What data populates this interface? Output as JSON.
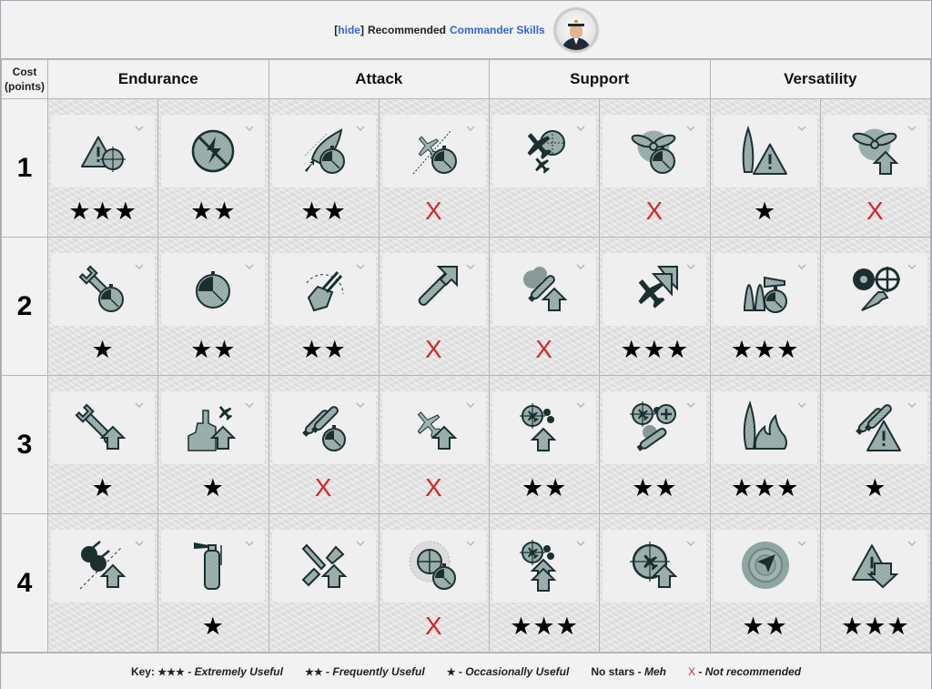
{
  "header": {
    "hide_link": "hide",
    "bracket_open": "[",
    "bracket_close": "]",
    "title_plain": "Recommended",
    "title_link": "Commander Skills",
    "avatar_icon": "commander-portrait-icon"
  },
  "columns": {
    "cost_header_line1": "Cost",
    "cost_header_line2": "(points)",
    "categories": [
      "Endurance",
      "Attack",
      "Support",
      "Versatility"
    ]
  },
  "rows": [
    {
      "cost": "1",
      "skills": [
        {
          "icon": "warning-triangle-target-icon",
          "rating": "★★★"
        },
        {
          "icon": "no-flooding-icon",
          "rating": "★★"
        },
        {
          "icon": "ship-speed-timer-icon",
          "rating": "★★"
        },
        {
          "icon": "aircraft-timer-icon",
          "rating": "X"
        },
        {
          "icon": "fighter-planes-target-icon",
          "rating": ""
        },
        {
          "icon": "propeller-timer-icon",
          "rating": "X"
        },
        {
          "icon": "ship-warning-icon",
          "rating": "★"
        },
        {
          "icon": "propeller-upgrade-icon",
          "rating": "X"
        }
      ]
    },
    {
      "cost": "2",
      "skills": [
        {
          "icon": "wrench-timer-icon",
          "rating": "★"
        },
        {
          "icon": "stopwatch-icon",
          "rating": "★★"
        },
        {
          "icon": "turret-rotation-icon",
          "rating": "★★"
        },
        {
          "icon": "torpedo-upgrade-icon",
          "rating": "X"
        },
        {
          "icon": "smoke-generator-upgrade-icon",
          "rating": "X"
        },
        {
          "icon": "aircraft-speed-upgrade-icon",
          "rating": "★★★"
        },
        {
          "icon": "ships-timer-icon",
          "rating": "★★★"
        },
        {
          "icon": "engine-steering-repair-icon",
          "rating": ""
        }
      ]
    },
    {
      "cost": "3",
      "skills": [
        {
          "icon": "wrench-upgrade-icon",
          "rating": "★"
        },
        {
          "icon": "battleship-aircraft-upgrade-icon",
          "rating": "★"
        },
        {
          "icon": "torpedo-reload-timer-icon",
          "rating": "X"
        },
        {
          "icon": "aircraft-upgrade-icon",
          "rating": "X"
        },
        {
          "icon": "aa-guns-upgrade-icon",
          "rating": "★★"
        },
        {
          "icon": "aa-smoke-plus-icon",
          "rating": "★★"
        },
        {
          "icon": "ship-fire-icon",
          "rating": "★★★"
        },
        {
          "icon": "torpedo-warning-icon",
          "rating": "★"
        }
      ]
    },
    {
      "cost": "4",
      "skills": [
        {
          "icon": "secondary-guns-upgrade-icon",
          "rating": ""
        },
        {
          "icon": "fire-extinguisher-icon",
          "rating": "★"
        },
        {
          "icon": "armor-piercing-upgrade-icon",
          "rating": ""
        },
        {
          "icon": "radar-timer-icon",
          "rating": "X"
        },
        {
          "icon": "aa-guns-double-upgrade-icon",
          "rating": "★★★"
        },
        {
          "icon": "aa-target-upgrade-icon",
          "rating": ""
        },
        {
          "icon": "radar-navigation-icon",
          "rating": "★★"
        },
        {
          "icon": "warning-downgrade-icon",
          "rating": "★★★"
        }
      ]
    }
  ],
  "key": {
    "label": "Key:",
    "items": [
      {
        "symbol": "★★★",
        "text": "Extremely Useful"
      },
      {
        "symbol": "★★",
        "text": "Frequently Useful"
      },
      {
        "symbol": "★",
        "text": "Occasionally Useful"
      },
      {
        "symbol": "No stars",
        "text": "Meh"
      },
      {
        "symbol": "X",
        "text": "Not recommended"
      }
    ],
    "separator": " - "
  },
  "colors": {
    "link": "#3366cc",
    "not_recommended": "#cc2b2b",
    "icon_fill": "#9fb3b0",
    "icon_dark": "#1b2f31"
  }
}
